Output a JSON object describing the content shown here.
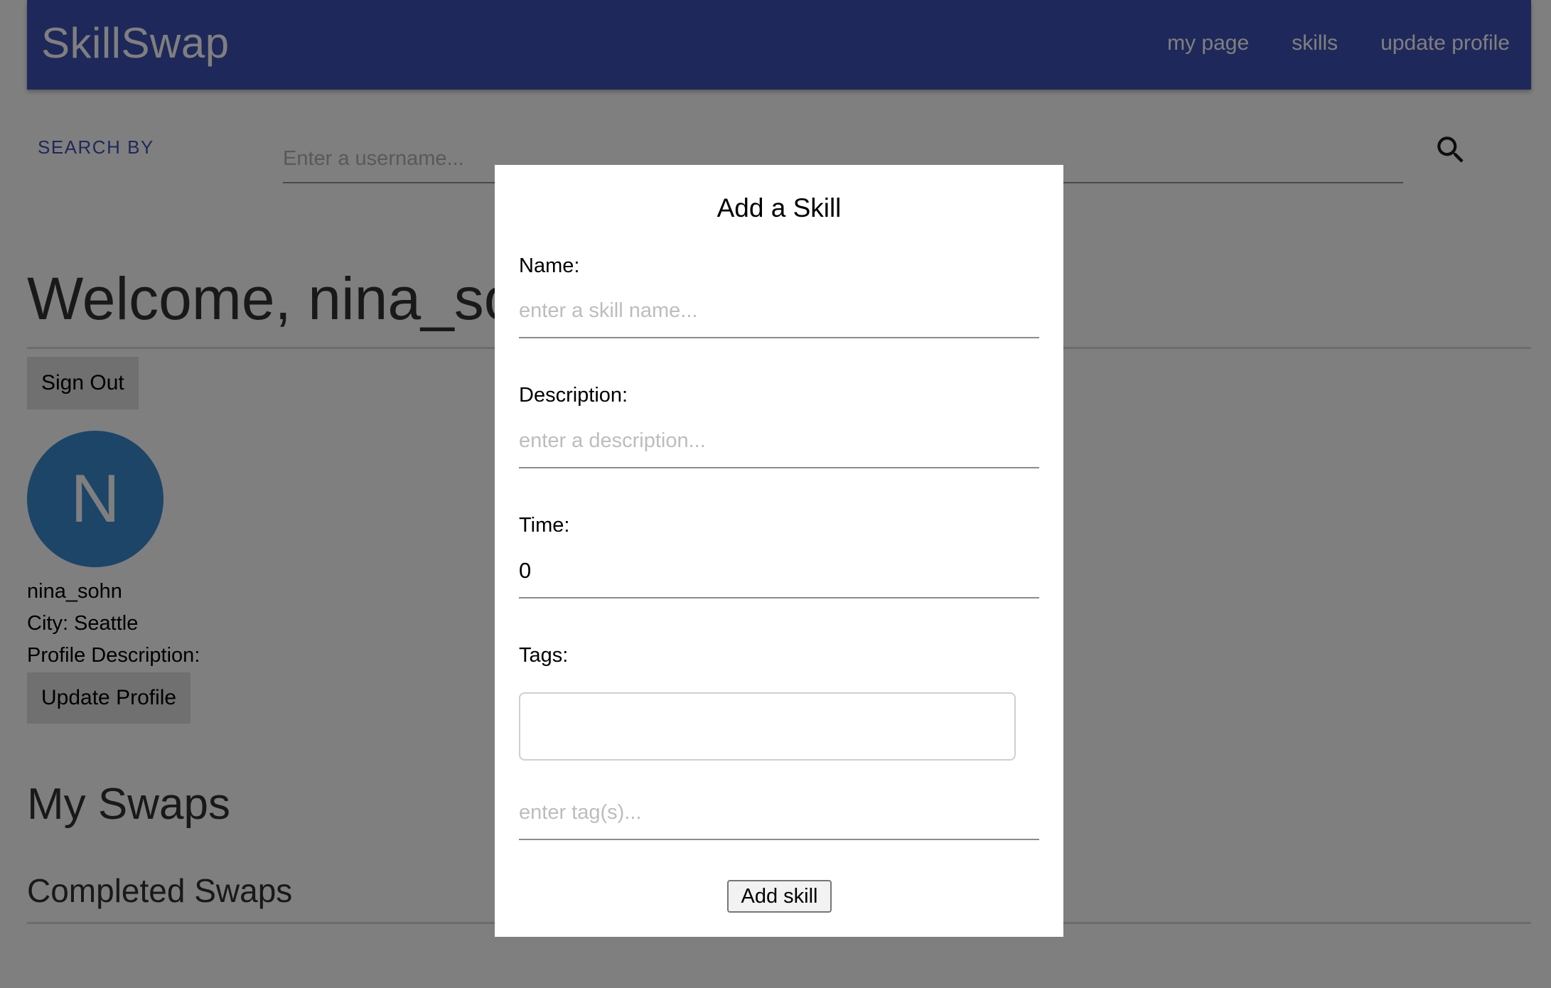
{
  "navbar": {
    "brand": "SkillSwap",
    "links": [
      "my page",
      "skills",
      "update profile"
    ]
  },
  "search": {
    "label": "SEARCH BY",
    "placeholder": "Enter a username...",
    "icon": "search-icon"
  },
  "profile": {
    "welcome": "Welcome, nina_sohn",
    "sign_out": "Sign Out",
    "avatar_letter": "N",
    "username": "nina_sohn",
    "city": "City: Seattle",
    "profile_description": "Profile Description:",
    "update_profile": "Update Profile"
  },
  "swaps": {
    "heading": "My Swaps",
    "completed_heading": "Completed Swaps"
  },
  "modal": {
    "title": "Add a Skill",
    "name_label": "Name:",
    "name_placeholder": "enter a skill name...",
    "description_label": "Description:",
    "description_placeholder": "enter a description...",
    "time_label": "Time:",
    "time_value": "0",
    "tags_label": "Tags:",
    "tags_placeholder": "enter tag(s)...",
    "submit": "Add skill"
  },
  "colors": {
    "navbar": "#3f51b5",
    "accent": "#3f51b5",
    "avatar": "#3a8bd0",
    "overlay": "rgba(0,0,0,0.5)"
  }
}
